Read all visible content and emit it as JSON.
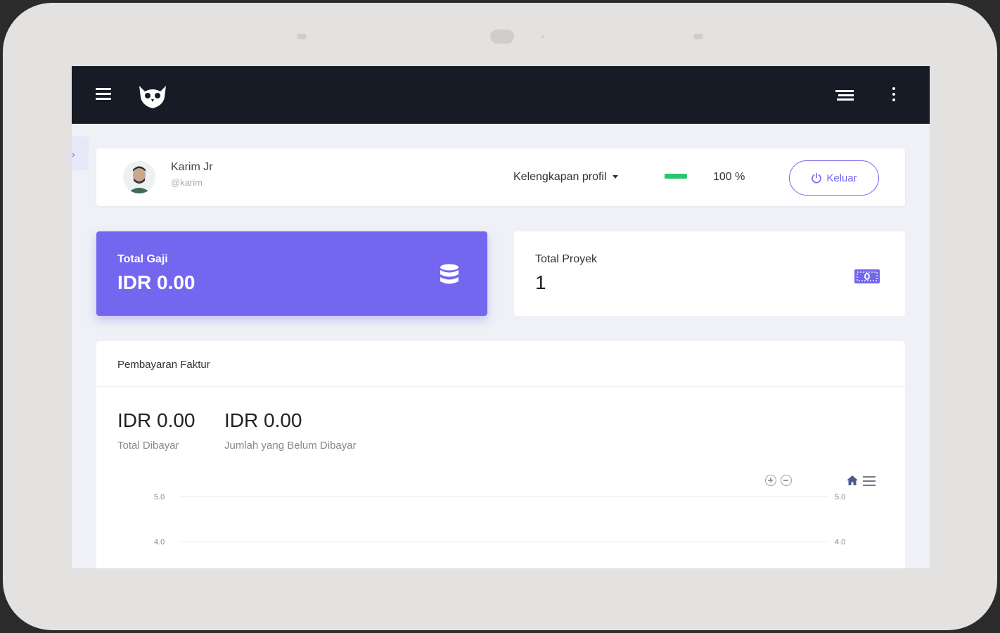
{
  "user": {
    "name": "Karim Jr",
    "handle": "@karim"
  },
  "profile": {
    "completeness_label": "Kelengkapan profil",
    "progress_percent": 100,
    "progress_text": "100 %"
  },
  "logout_label": "Keluar",
  "stats": {
    "salary": {
      "label": "Total Gaji",
      "value": "IDR 0.00"
    },
    "projects": {
      "label": "Total Proyek",
      "value": "1"
    }
  },
  "invoice": {
    "title": "Pembayaran Faktur",
    "paid": {
      "amount": "IDR 0.00",
      "label": "Total Dibayar"
    },
    "unpaid": {
      "amount": "IDR 0.00",
      "label": "Jumlah yang Belum Dibayar"
    }
  },
  "colors": {
    "accent": "#7367f0",
    "topbar": "#161b26",
    "success": "#28c76f"
  },
  "icons": {
    "menu": "hamburger-icon",
    "logo": "owl-logo-icon",
    "list": "list-icon",
    "more": "more-vertical-icon",
    "logout": "power-icon",
    "salary": "database-icon",
    "projects": "money-icon"
  },
  "chart_data": {
    "type": "line",
    "y_ticks_left": [
      "5.0",
      "4.0"
    ],
    "y_ticks_right": [
      "5.0",
      "4.0"
    ],
    "ylim": [
      4.0,
      5.0
    ],
    "series": []
  }
}
